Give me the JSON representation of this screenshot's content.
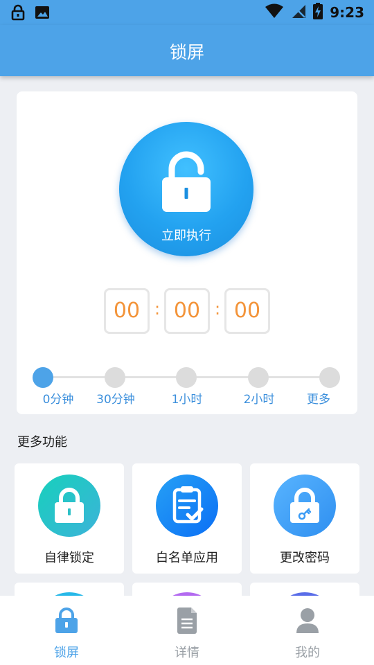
{
  "status_bar": {
    "time": "9:23"
  },
  "app_bar": {
    "title": "锁屏"
  },
  "lock_button": {
    "label": "立即执行"
  },
  "timer": {
    "hours": "00",
    "minutes": "00",
    "seconds": "00",
    "separator": ":"
  },
  "duration_slider": {
    "selected_index": 0,
    "options": [
      "0分钟",
      "30分钟",
      "1小时",
      "2小时",
      "更多"
    ]
  },
  "more_features": {
    "title": "更多功能",
    "items": [
      {
        "label": "自律锁定",
        "icon": "lock-icon"
      },
      {
        "label": "白名单应用",
        "icon": "clipboard-check-icon"
      },
      {
        "label": "更改密码",
        "icon": "lock-key-icon"
      }
    ]
  },
  "bottom_nav": {
    "items": [
      {
        "label": "锁屏",
        "icon": "lock-icon",
        "active": true
      },
      {
        "label": "详情",
        "icon": "document-icon",
        "active": false
      },
      {
        "label": "我的",
        "icon": "user-icon",
        "active": false
      }
    ]
  },
  "colors": {
    "primary": "#4da3e8",
    "timer_digits": "#f3943a",
    "inactive_nav": "#9aa0a6"
  }
}
